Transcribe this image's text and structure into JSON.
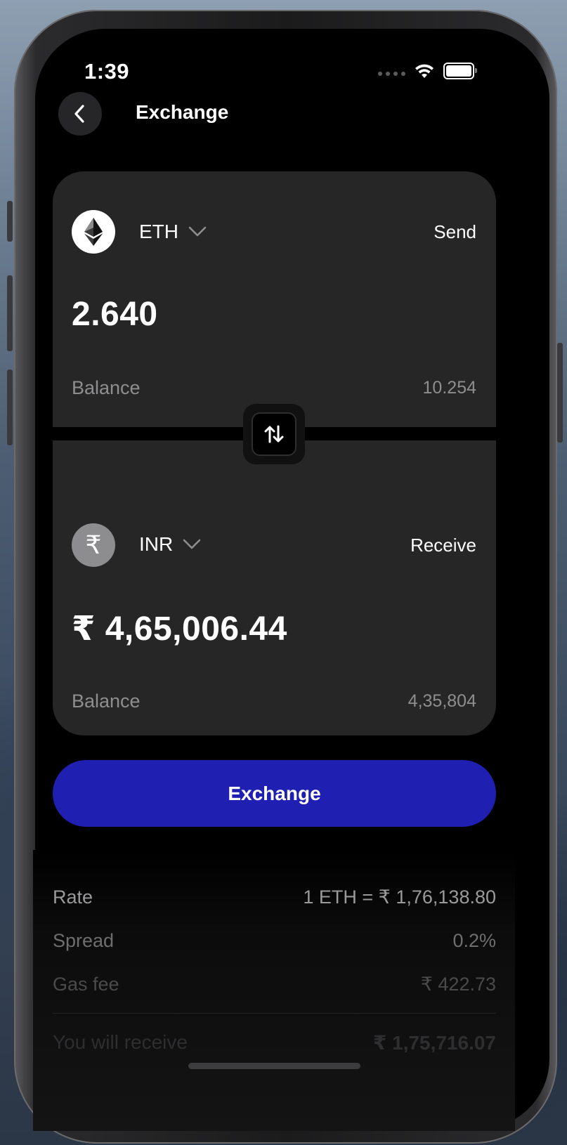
{
  "status": {
    "time": "1:39"
  },
  "header": {
    "title": "Exchange"
  },
  "send": {
    "currency": "ETH",
    "role": "Send",
    "amount": "2.640",
    "balance_label": "Balance",
    "balance_value": "10.254"
  },
  "receive": {
    "currency": "INR",
    "symbol": "₹",
    "role": "Receive",
    "amount": "₹ 4,65,006.44",
    "balance_label": "Balance",
    "balance_value": "4,35,804"
  },
  "action": {
    "exchange_label": "Exchange"
  },
  "details": {
    "rate_label": "Rate",
    "rate_value": "1 ETH = ₹ 1,76,138.80",
    "spread_label": "Spread",
    "spread_value": "0.2%",
    "gas_label": "Gas fee",
    "gas_value": "₹ 422.73",
    "receive_label": "You will receive",
    "receive_value": "₹ 1,75,716.07"
  },
  "colors": {
    "accent": "#1f1fb1",
    "card": "#262626",
    "background": "#000000"
  },
  "icons": {
    "back": "chevron-left-icon",
    "eth": "ethereum-icon",
    "inr": "rupee-icon",
    "swap": "swap-vertical-icon",
    "dropdown": "chevron-down-icon",
    "wifi": "wifi-icon",
    "battery": "battery-icon"
  }
}
